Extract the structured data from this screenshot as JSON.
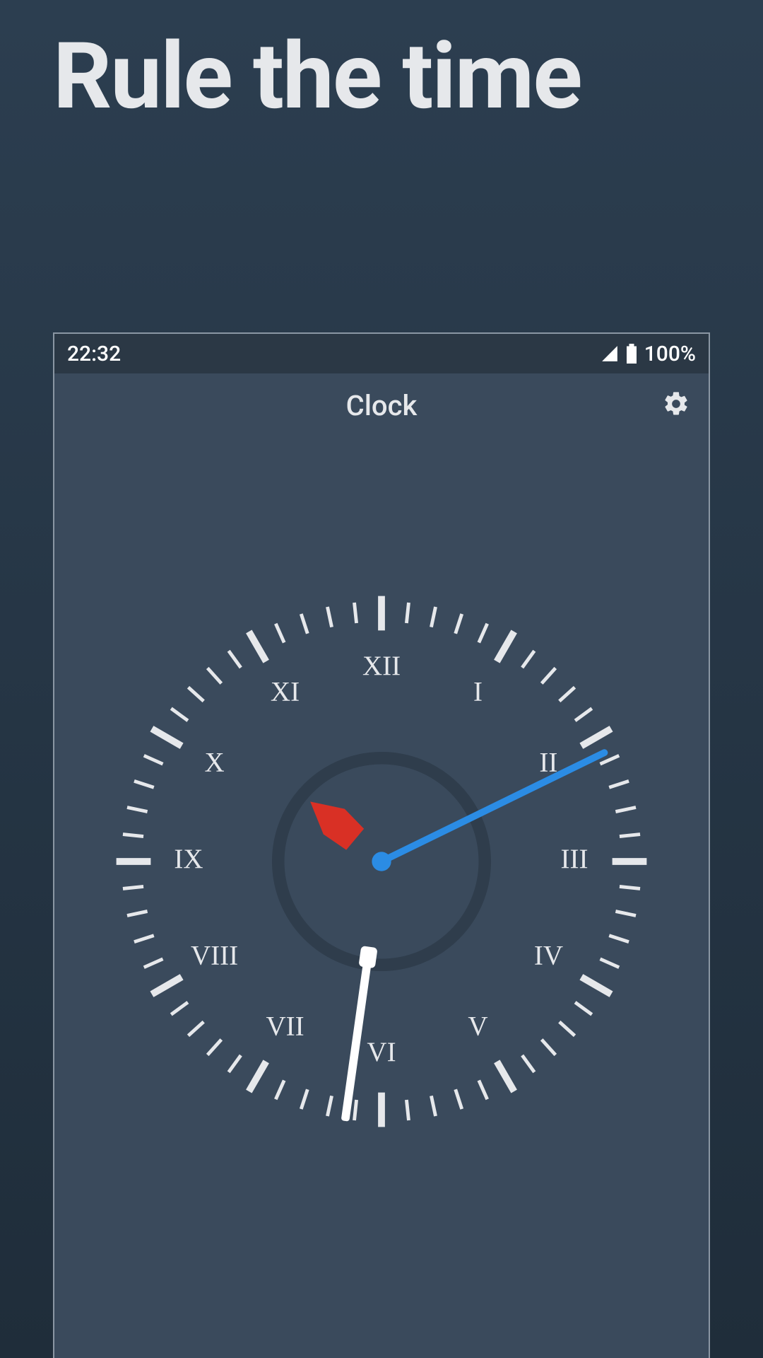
{
  "headline": "Rule the time",
  "status": {
    "time": "22:32",
    "battery": "100%"
  },
  "app": {
    "title": "Clock"
  },
  "clock": {
    "numerals": [
      "XII",
      "I",
      "II",
      "III",
      "IV",
      "V",
      "VI",
      "VII",
      "VIII",
      "IX",
      "X",
      "XI"
    ],
    "hour_hand_angle": -50,
    "minute_hand_angle": 188,
    "second_hand_angle": 64,
    "hour_hand_color": "#d93025",
    "minute_hand_color": "#ffffff",
    "second_hand_color": "#2b8ce4"
  }
}
